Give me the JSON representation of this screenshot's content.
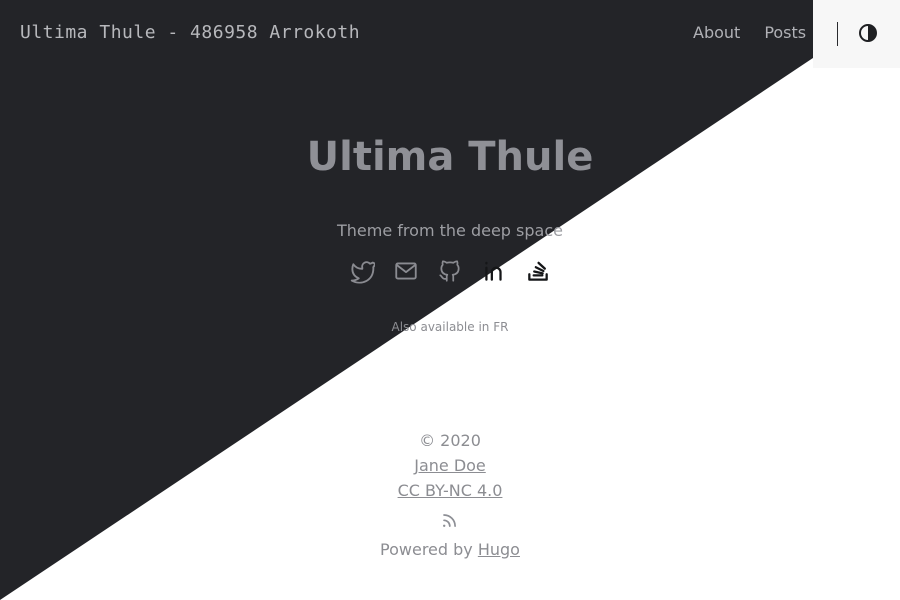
{
  "site": {
    "title": "Ultima Thule - 486958 Arrokoth"
  },
  "nav": {
    "about": "About",
    "posts": "Posts"
  },
  "theme": {
    "dark_bg": "#232428",
    "light_bg": "#ffffff",
    "panel_bg": "#f7f7f7",
    "toggle_icon": "contrast-icon"
  },
  "hero": {
    "title": "Ultima Thule",
    "subtitle": "Theme from the deep space"
  },
  "socials": [
    {
      "icon": "twitter-icon"
    },
    {
      "icon": "mail-icon"
    },
    {
      "icon": "github-icon"
    },
    {
      "icon": "linkedin-icon"
    },
    {
      "icon": "stackoverflow-icon"
    }
  ],
  "language": {
    "prefix": "Also available in",
    "link": "FR"
  },
  "footer": {
    "copyright": "© 2020",
    "author": "Jane Doe",
    "license": "CC BY-NC 4.0",
    "rss_icon": "rss-icon",
    "powered_prefix": "Powered by",
    "powered_link": "Hugo"
  }
}
